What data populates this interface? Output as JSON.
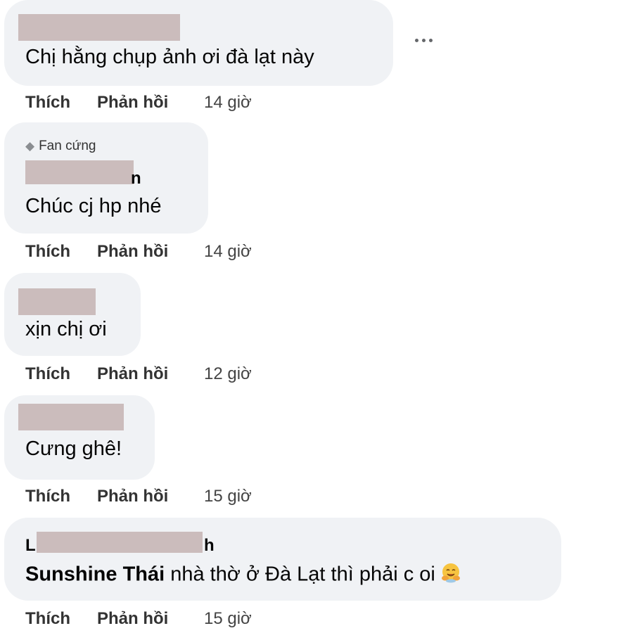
{
  "comments": [
    {
      "text": "Chị hằng chụp ảnh ơi đà lạt này",
      "like_label": "Thích",
      "reply_label": "Phản hồi",
      "time": "14 giờ"
    },
    {
      "badge": "Fan cứng",
      "name_fragment": "n",
      "text": "Chúc cj hp nhé",
      "like_label": "Thích",
      "reply_label": "Phản hồi",
      "time": "14 giờ"
    },
    {
      "text": "xịn chị ơi",
      "like_label": "Thích",
      "reply_label": "Phản hồi",
      "time": "12 giờ"
    },
    {
      "text": "Cưng ghê!",
      "like_label": "Thích",
      "reply_label": "Phản hồi",
      "time": "15 giờ"
    },
    {
      "name_fragment_start": "L",
      "name_fragment_end": "h",
      "mention": "Sunshine Thái",
      "text": " nhà thờ ở Đà Lạt thì phải c oi",
      "emoji": "hug-face-emoji",
      "like_label": "Thích",
      "reply_label": "Phản hồi",
      "time": "15 giờ"
    }
  ],
  "icons": {
    "more": "more-horizontal-icon",
    "badge": "diamond-icon"
  }
}
